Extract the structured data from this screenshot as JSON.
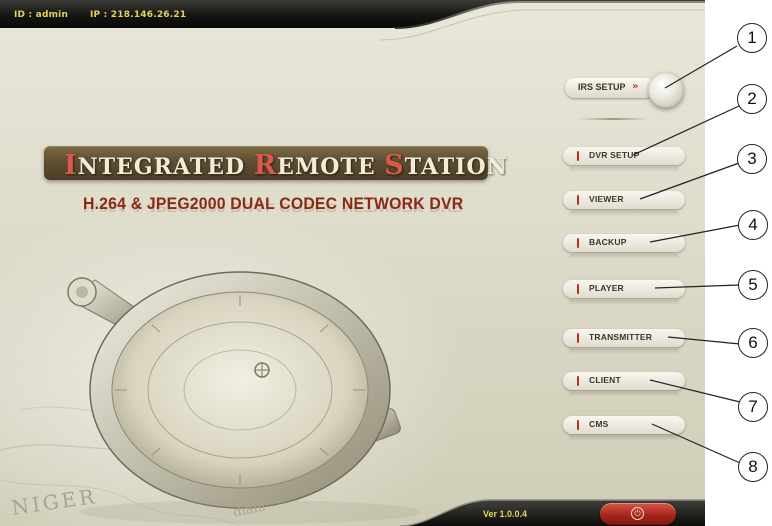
{
  "header": {
    "id_text": "ID : admin",
    "ip_text": "IP : 218.146.26.21"
  },
  "title": {
    "words": [
      {
        "cap": "I",
        "rest": "NTEGRATED"
      },
      {
        "cap": "R",
        "rest": "EMOTE"
      },
      {
        "cap": "S",
        "rest": "TATION"
      }
    ],
    "subtitle": "H.264 & JPEG2000 DUAL CODEC NETWORK DVR"
  },
  "irs_setup": {
    "label": "IRS SETUP",
    "arrow": "»"
  },
  "menu": [
    {
      "label": "DVR SETUP",
      "callout": "2"
    },
    {
      "label": "VIEWER",
      "callout": "3"
    },
    {
      "label": "BACKUP",
      "callout": "4"
    },
    {
      "label": "PLAYER",
      "callout": "5"
    },
    {
      "label": "TRANSMITTER",
      "callout": "6"
    },
    {
      "label": "CLIENT",
      "callout": "7"
    },
    {
      "label": "CMS",
      "callout": "8"
    }
  ],
  "footer": {
    "version": "Ver 1.0.0.4",
    "power_icon": "power-icon"
  },
  "background": {
    "map_text_1": "NIGER",
    "map_text_2": "diam"
  },
  "callouts": [
    "1",
    "2",
    "3",
    "4",
    "5",
    "6",
    "7",
    "8"
  ],
  "colors": {
    "accent_yellow": "#e6d15a",
    "accent_red": "#b7321e",
    "title_banner": "#5f4f32",
    "subtitle": "#8a2a14"
  }
}
